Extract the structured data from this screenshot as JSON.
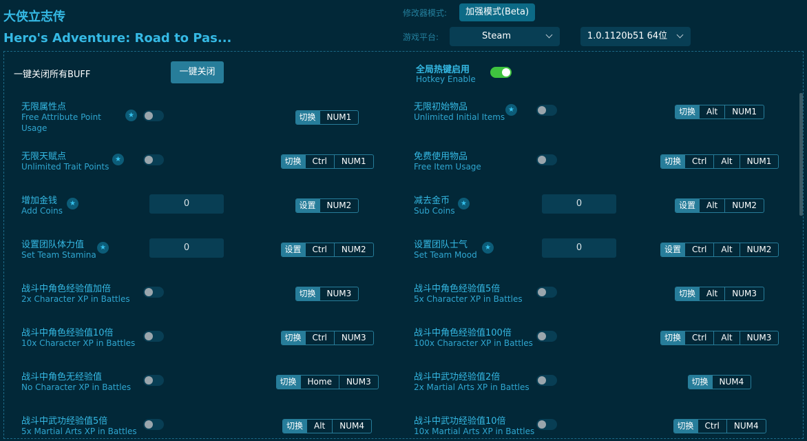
{
  "app": {
    "title_cn": "大侠立志传",
    "title_en": "Hero's Adventure: Road to Pas..."
  },
  "header": {
    "mode_label": "修改器模式:",
    "mode_value": "加强模式(Beta)",
    "platform_label": "游戏平台:",
    "platform_value": "Steam",
    "version_value": "1.0.1120b51 64位"
  },
  "global": {
    "close_all_label": "一键关闭所有BUFF",
    "close_all_button": "一键关闭",
    "hotkey_cn": "全局热键启用",
    "hotkey_en": "Hotkey Enable",
    "hotkey_enabled": true
  },
  "colors": {
    "background": "#022838",
    "accent": "#277d9a",
    "text_accent": "#35b9e4",
    "toggle_on": "#3fc33f"
  },
  "cheats": [
    {
      "cn": "无限属性点",
      "en": "Free Attribute Point Usage",
      "star": true,
      "control": "toggle",
      "on": false,
      "action": "切换",
      "keys": [
        "NUM1"
      ]
    },
    {
      "cn": "无限初始物品",
      "en": "Unlimited Initial Items",
      "star": true,
      "control": "toggle",
      "on": false,
      "action": "切换",
      "keys": [
        "Alt",
        "NUM1"
      ]
    },
    {
      "cn": "无限天赋点",
      "en": "Unlimited Trait Points",
      "star": true,
      "control": "toggle",
      "on": false,
      "action": "切换",
      "keys": [
        "Ctrl",
        "NUM1"
      ]
    },
    {
      "cn": "免费使用物品",
      "en": "Free Item Usage",
      "star": false,
      "control": "toggle",
      "on": false,
      "action": "切换",
      "keys": [
        "Ctrl",
        "Alt",
        "NUM1"
      ]
    },
    {
      "cn": "增加金钱",
      "en": "Add Coins",
      "star": true,
      "control": "input",
      "value": "0",
      "action": "设置",
      "keys": [
        "NUM2"
      ]
    },
    {
      "cn": "减去金币",
      "en": "Sub Coins",
      "star": true,
      "control": "input",
      "value": "0",
      "action": "设置",
      "keys": [
        "Alt",
        "NUM2"
      ]
    },
    {
      "cn": "设置团队体力值",
      "en": "Set Team Stamina",
      "star": true,
      "control": "input",
      "value": "0",
      "action": "设置",
      "keys": [
        "Ctrl",
        "NUM2"
      ]
    },
    {
      "cn": "设置团队士气",
      "en": "Set Team Mood",
      "star": true,
      "control": "input",
      "value": "0",
      "action": "设置",
      "keys": [
        "Ctrl",
        "Alt",
        "NUM2"
      ]
    },
    {
      "cn": "战斗中角色经验值加倍",
      "en": "2x Character XP in Battles",
      "star": false,
      "control": "toggle",
      "on": false,
      "action": "切换",
      "keys": [
        "NUM3"
      ]
    },
    {
      "cn": "战斗中角色经验值5倍",
      "en": "5x Character XP in Battles",
      "star": false,
      "control": "toggle",
      "on": false,
      "action": "切换",
      "keys": [
        "Alt",
        "NUM3"
      ]
    },
    {
      "cn": "战斗中角色经验值10倍",
      "en": "10x Character XP in Battles",
      "star": false,
      "control": "toggle",
      "on": false,
      "action": "切换",
      "keys": [
        "Ctrl",
        "NUM3"
      ]
    },
    {
      "cn": "战斗中角色经验值100倍",
      "en": "100x Character XP in Battles",
      "star": false,
      "control": "toggle",
      "on": false,
      "action": "切换",
      "keys": [
        "Ctrl",
        "Alt",
        "NUM3"
      ]
    },
    {
      "cn": "战斗中角色无经验值",
      "en": "No Character XP in Battles",
      "star": false,
      "control": "toggle",
      "on": false,
      "action": "切换",
      "keys": [
        "Home",
        "NUM3"
      ]
    },
    {
      "cn": "战斗中武功经验值2倍",
      "en": "2x Martial Arts XP in Battles",
      "star": false,
      "control": "toggle",
      "on": false,
      "action": "切换",
      "keys": [
        "NUM4"
      ]
    },
    {
      "cn": "战斗中武功经验值5倍",
      "en": "5x Martial Arts XP in Battles",
      "star": false,
      "control": "toggle",
      "on": false,
      "action": "切换",
      "keys": [
        "Alt",
        "NUM4"
      ]
    },
    {
      "cn": "战斗中武功经验值10倍",
      "en": "10x Martial Arts XP in Battles",
      "star": false,
      "control": "toggle",
      "on": false,
      "action": "切换",
      "keys": [
        "Ctrl",
        "NUM4"
      ]
    }
  ]
}
